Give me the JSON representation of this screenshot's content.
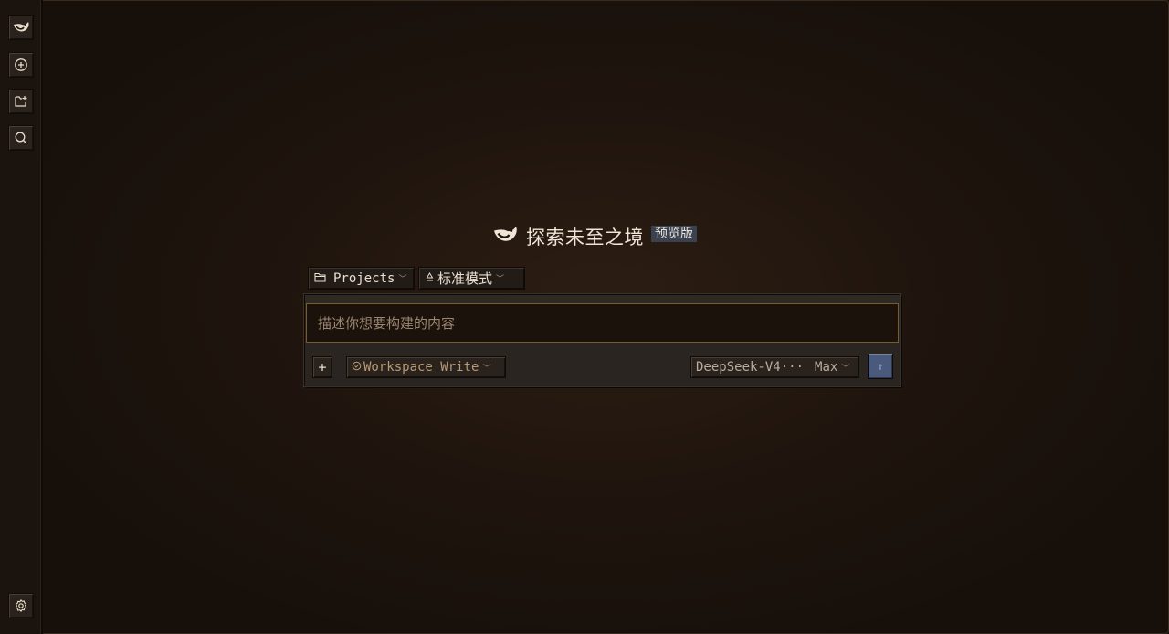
{
  "hero": {
    "title": "探索未至之境",
    "badge": "预览版"
  },
  "chips": {
    "projects": "Projects",
    "mode": "标准模式"
  },
  "composer": {
    "placeholder": "描述你想要构建的内容",
    "add": "+",
    "permission": "Workspace Write",
    "model": "DeepSeek-V4···",
    "effort": "Max",
    "send": "↑"
  },
  "sidebar": {
    "icons": [
      "logo-icon",
      "new-chat-icon",
      "new-project-icon",
      "search-icon",
      "settings-icon"
    ]
  },
  "colors": {
    "accent_border": "#7b5a2c",
    "send_button": "#4a5a7c",
    "badge_bg": "#3a4250"
  }
}
